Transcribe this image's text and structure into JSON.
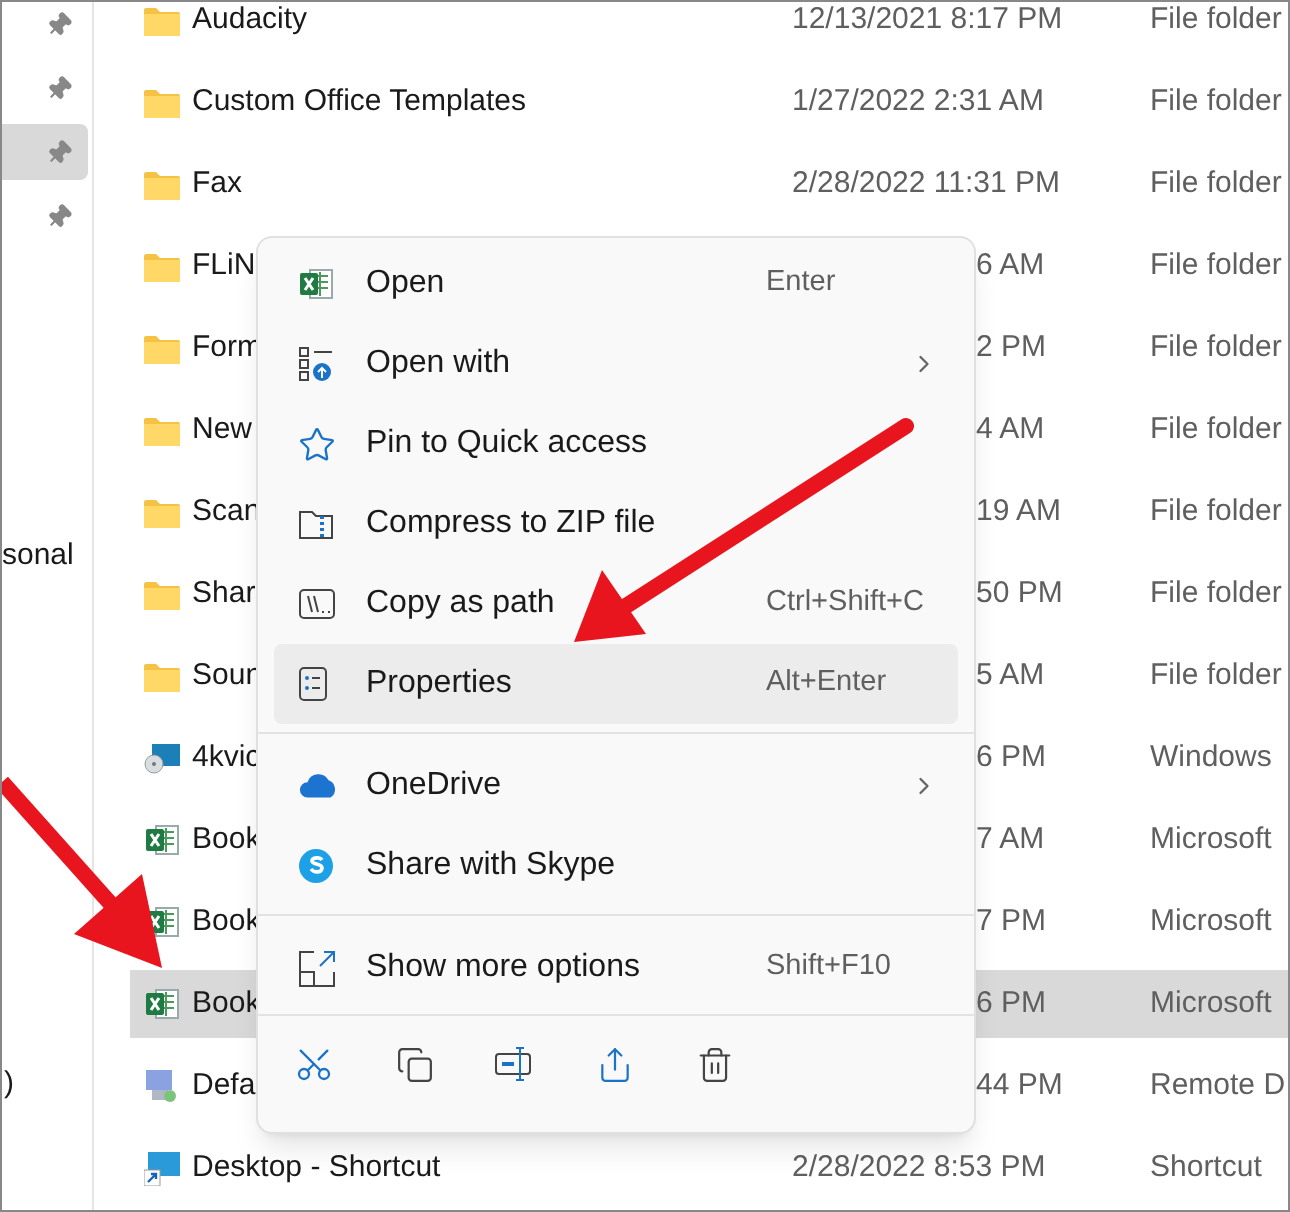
{
  "sidebar": {
    "pins": [
      {
        "selected": false
      },
      {
        "selected": false
      },
      {
        "selected": true
      },
      {
        "selected": false
      }
    ],
    "labels": [
      {
        "text": "sonal"
      },
      {
        "text": ")"
      }
    ]
  },
  "files": [
    {
      "kind": "folder",
      "name": "Audacity",
      "date": "12/13/2021 8:17 PM",
      "type": "File folder",
      "selected": false,
      "covered": false
    },
    {
      "kind": "folder",
      "name": "Custom Office Templates",
      "date": "1/27/2022 2:31 AM",
      "type": "File folder",
      "selected": false,
      "covered": false
    },
    {
      "kind": "folder",
      "name": "Fax",
      "date": "2/28/2022 11:31 PM",
      "type": "File folder",
      "selected": false,
      "covered": false
    },
    {
      "kind": "folder",
      "name": "FLiN",
      "date": "6 AM",
      "type": "File folder",
      "selected": false,
      "covered": true
    },
    {
      "kind": "folder",
      "name": "Form",
      "date": "2 PM",
      "type": "File folder",
      "selected": false,
      "covered": true
    },
    {
      "kind": "folder",
      "name": "New",
      "date": "4 AM",
      "type": "File folder",
      "selected": false,
      "covered": true
    },
    {
      "kind": "folder",
      "name": "Scan",
      "date": "19 AM",
      "type": "File folder",
      "selected": false,
      "covered": true
    },
    {
      "kind": "folder",
      "name": "Shar",
      "date": "50 PM",
      "type": "File folder",
      "selected": false,
      "covered": true
    },
    {
      "kind": "folder",
      "name": "Soun",
      "date": "5 AM",
      "type": "File folder",
      "selected": false,
      "covered": true
    },
    {
      "kind": "app",
      "name": "4kvic",
      "date": "6 PM",
      "type": "Windows",
      "selected": false,
      "covered": true
    },
    {
      "kind": "excel",
      "name": "Book",
      "date": "7 AM",
      "type": "Microsoft",
      "selected": false,
      "covered": true
    },
    {
      "kind": "excel",
      "name": "Book",
      "date": "7 PM",
      "type": "Microsoft",
      "selected": false,
      "covered": true
    },
    {
      "kind": "excel",
      "name": "Book",
      "date": "6 PM",
      "type": "Microsoft",
      "selected": true,
      "covered": true
    },
    {
      "kind": "remote",
      "name": "Defa",
      "date": "44 PM",
      "type": "Remote D",
      "selected": false,
      "covered": true
    },
    {
      "kind": "shortcut",
      "name": "Desktop - Shortcut",
      "date": "2/28/2022 8:53 PM",
      "type": "Shortcut",
      "selected": false,
      "covered": false
    }
  ],
  "context_menu": {
    "groups": [
      [
        {
          "label": "Open",
          "shortcut": "Enter",
          "submenu": false,
          "selected": false
        },
        {
          "label": "Open with",
          "submenu": true,
          "selected": false
        },
        {
          "label": "Pin to Quick access",
          "submenu": false,
          "selected": false
        },
        {
          "label": "Compress to ZIP file",
          "submenu": false,
          "selected": false
        },
        {
          "label": "Copy as path",
          "shortcut": "Ctrl+Shift+C",
          "submenu": false,
          "selected": false
        },
        {
          "label": "Properties",
          "shortcut": "Alt+Enter",
          "submenu": false,
          "selected": true
        }
      ],
      [
        {
          "label": "OneDrive",
          "submenu": true,
          "selected": false
        },
        {
          "label": "Share with Skype",
          "submenu": false,
          "selected": false
        }
      ],
      [
        {
          "label": "Show more options",
          "shortcut": "Shift+F10",
          "submenu": false,
          "selected": false
        }
      ]
    ]
  }
}
